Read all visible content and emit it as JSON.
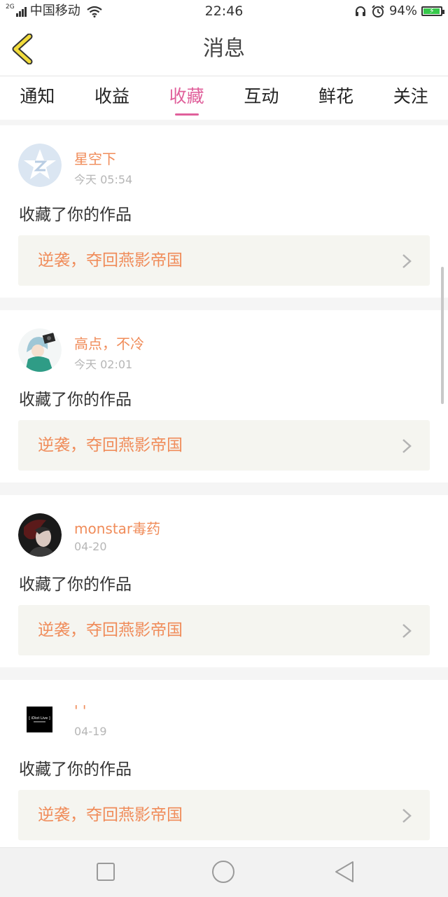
{
  "status_bar": {
    "network_type": "2G",
    "carrier": "中国移动",
    "time": "22:46",
    "battery": "94%",
    "battery_level": 0.94,
    "battery_color": "#36c84a"
  },
  "header": {
    "title": "消息"
  },
  "tabs": [
    {
      "label": "通知",
      "active": false
    },
    {
      "label": "收益",
      "active": false
    },
    {
      "label": "收藏",
      "active": true
    },
    {
      "label": "互动",
      "active": false
    },
    {
      "label": "鲜花",
      "active": false
    },
    {
      "label": "关注",
      "active": false
    }
  ],
  "colors": {
    "accent": "#e0609b",
    "name_color": "#f08c5a",
    "work_bg": "#f5f5f0"
  },
  "messages": [
    {
      "username": "星空下",
      "time": "今天 05:54",
      "action": "收藏了你的作品",
      "work_title": "逆袭，夺回燕影帝国",
      "avatar": "default-qq-avatar"
    },
    {
      "username": "高点，不冷",
      "time": "今天 02:01",
      "action": "收藏了你的作品",
      "work_title": "逆袭，夺回燕影帝国",
      "avatar": "anime-character-avatar"
    },
    {
      "username": "monstar毒药",
      "time": "04-20",
      "action": "收藏了你的作品",
      "work_title": "逆袭，夺回燕影帝国",
      "avatar": "dark-portrait-avatar"
    },
    {
      "username": "' '",
      "time": "04-19",
      "action": "收藏了你的作品",
      "work_title": "逆袭，夺回燕影帝国",
      "avatar": "black-logo-avatar",
      "avatar_text": "[ iDiot Live ]"
    }
  ]
}
